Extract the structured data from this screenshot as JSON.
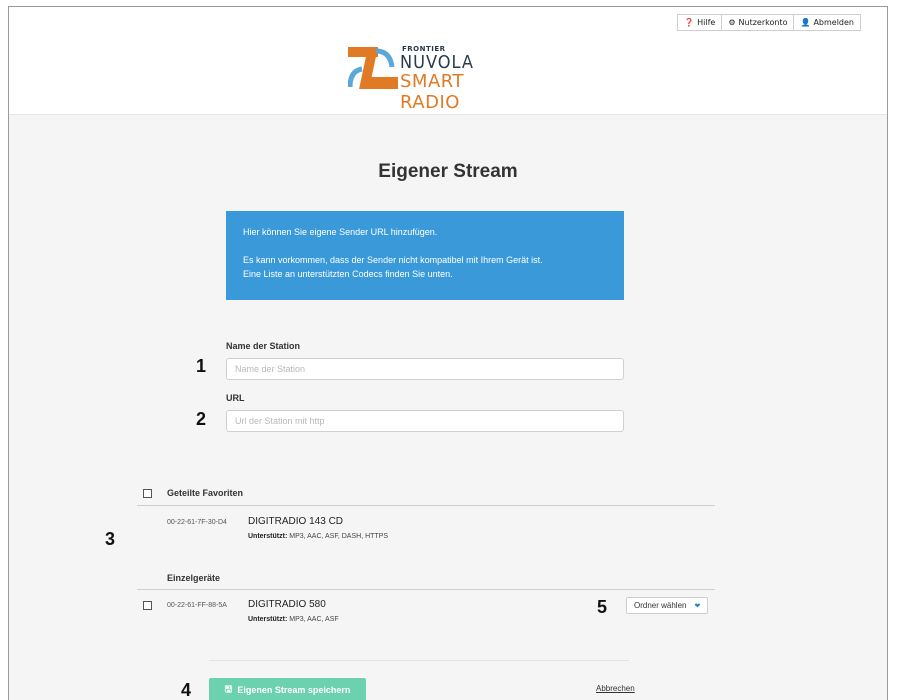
{
  "topnav": {
    "help": "Hilfe",
    "account": "Nutzerkonto",
    "logout": "Abmelden"
  },
  "logo": {
    "brand": "FRONTIER",
    "line1": "NUVOLA",
    "line2": "SMART RADIO",
    "colors": {
      "orange": "#e17a24",
      "navy": "#2b3a4a",
      "blue": "#5aa7d8"
    }
  },
  "page": {
    "title": "Eigener Stream"
  },
  "info": {
    "line1": "Hier können Sie eigene Sender URL hinzufügen.",
    "line2": "Es kann vorkommen, dass der Sender nicht kompatibel mit Ihrem Gerät ist.",
    "line3": "Eine Liste an unterstützten Codecs finden Sie unten."
  },
  "form": {
    "name_label": "Name der Station",
    "name_placeholder": "Name der Station",
    "name_value": "",
    "url_label": "URL",
    "url_placeholder": "Url der Station mit http",
    "url_value": ""
  },
  "markers": {
    "m1": "1",
    "m2": "2",
    "m3": "3",
    "m4": "4",
    "m5": "5"
  },
  "shared": {
    "heading": "Geteilte Favoriten",
    "checked": false,
    "device": {
      "mac": "00-22-61-7F-30-D4",
      "name": "DIGITRADIO 143 CD",
      "supported_label": "Unterstützt:",
      "supported": "MP3, AAC, ASF, DASH, HTTPS"
    }
  },
  "single": {
    "heading": "Einzelgeräte",
    "device": {
      "checked": false,
      "mac": "00-22-61-FF-88-5A",
      "name": "DIGITRADIO 580",
      "supported_label": "Unterstützt:",
      "supported": "MP3, AAC, ASF",
      "folder_select": "Ordner wählen"
    }
  },
  "actions": {
    "save": "Eigenen Stream speichern",
    "cancel": "Abbrechen",
    "save_color": "#6bd1ae"
  },
  "colors": {
    "info_bg": "#3a9ad9",
    "page_bg": "#f5f5f5"
  }
}
